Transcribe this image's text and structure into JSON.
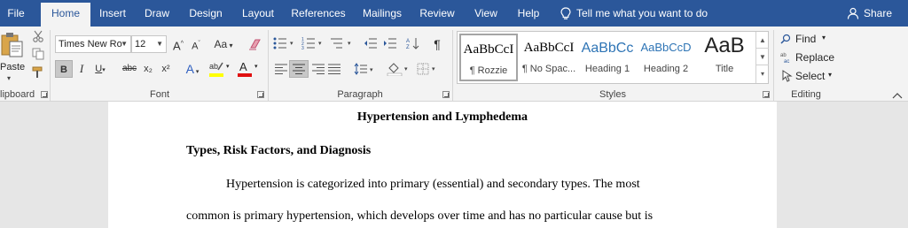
{
  "tabs": [
    "File",
    "Home",
    "Insert",
    "Draw",
    "Design",
    "Layout",
    "References",
    "Mailings",
    "Review",
    "View",
    "Help"
  ],
  "active_tab": "Home",
  "tell_me": "Tell me what you want to do",
  "share": "Share",
  "clipboard": {
    "paste": "Paste",
    "label": "lipboard"
  },
  "font": {
    "name": "Times New Ro",
    "size": "12",
    "grow": "A",
    "shrink": "A",
    "case": "Aa",
    "bold": "B",
    "italic": "I",
    "underline": "U",
    "strike": "abc",
    "subscript": "x₂",
    "superscript": "x²",
    "effects": "A",
    "font_color": "A",
    "label": "Font",
    "highlight_color": "#ffff00",
    "color": "#e01010"
  },
  "paragraph": {
    "label": "Paragraph",
    "pilcrow": "¶"
  },
  "styles": {
    "label": "Styles",
    "items": [
      {
        "sample": "AaBbCcI",
        "name": "¶ Rozzie"
      },
      {
        "sample": "AaBbCcI",
        "name": "¶ No Spac..."
      },
      {
        "sample": "AaBbCc",
        "name": "Heading 1"
      },
      {
        "sample": "AaBbCcD",
        "name": "Heading 2"
      },
      {
        "sample": "AaB",
        "name": "Title"
      }
    ]
  },
  "editing": {
    "find": "Find",
    "replace": "Replace",
    "select": "Select",
    "label": "Editing"
  },
  "document": {
    "title": "Hypertension and Lymphedema",
    "heading": "Types, Risk Factors, and Diagnosis",
    "line1": "Hypertension is categorized into primary (essential) and secondary types. The most",
    "line2": "common is primary hypertension, which develops over time and has no particular cause but is"
  }
}
